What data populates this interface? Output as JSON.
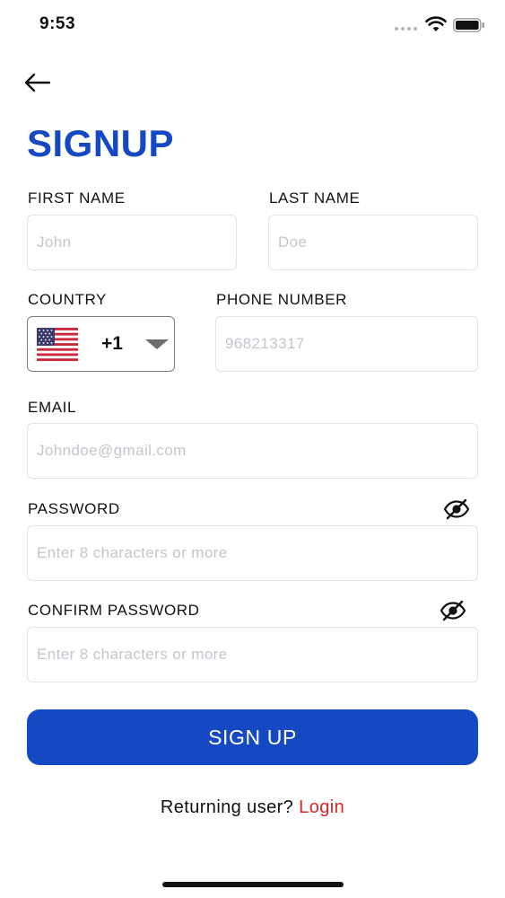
{
  "status_bar": {
    "time": "9:53"
  },
  "header": {
    "back_icon": "arrow-left-icon",
    "title": "SIGNUP"
  },
  "form": {
    "first_name": {
      "label": "FIRST NAME",
      "placeholder": "John",
      "value": ""
    },
    "last_name": {
      "label": "LAST NAME",
      "placeholder": "Doe",
      "value": ""
    },
    "country": {
      "label": "COUNTRY",
      "flag_icon": "us-flag-icon",
      "dial_code": "+1"
    },
    "phone": {
      "label": "PHONE NUMBER",
      "placeholder": "968213317",
      "value": ""
    },
    "email": {
      "label": "EMAIL",
      "placeholder": "Johndoe@gmail.com",
      "value": ""
    },
    "password": {
      "label": "PASSWORD",
      "placeholder": "Enter 8 characters or more",
      "value": "",
      "toggle_icon": "eye-slash-icon"
    },
    "confirm_password": {
      "label": "CONFIRM PASSWORD",
      "placeholder": "Enter 8 characters or more",
      "value": "",
      "toggle_icon": "eye-slash-icon"
    }
  },
  "submit": {
    "label": "SIGN UP"
  },
  "footer": {
    "prompt": "Returning user?",
    "link": "Login"
  },
  "colors": {
    "primary": "#1549c3",
    "link": "#e02424",
    "placeholder": "#c3c6cc",
    "field_border": "#e1e3e8"
  }
}
